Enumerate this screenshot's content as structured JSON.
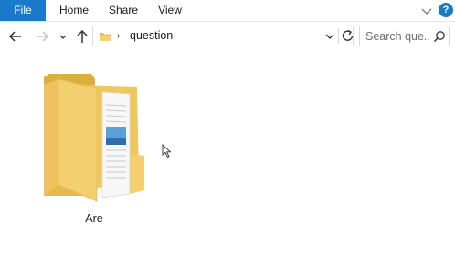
{
  "ribbon": {
    "tabs": [
      {
        "label": "File",
        "active": true
      },
      {
        "label": "Home",
        "active": false
      },
      {
        "label": "Share",
        "active": false
      },
      {
        "label": "View",
        "active": false
      }
    ],
    "help_label": "?",
    "accent_color": "#1979ca"
  },
  "navigation": {
    "back_icon": "arrow-left-icon",
    "forward_icon": "arrow-right-icon",
    "recent_icon": "chevron-down-icon",
    "up_icon": "arrow-up-icon",
    "breadcrumb_separator": "›",
    "path": "question",
    "refresh_icon": "refresh-icon"
  },
  "search": {
    "placeholder": "Search que...",
    "icon": "search-icon"
  },
  "content": {
    "items": [
      {
        "name": "Are",
        "type": "folder",
        "icon": "folder-icon"
      }
    ],
    "folder_color": "#f4cf70"
  }
}
